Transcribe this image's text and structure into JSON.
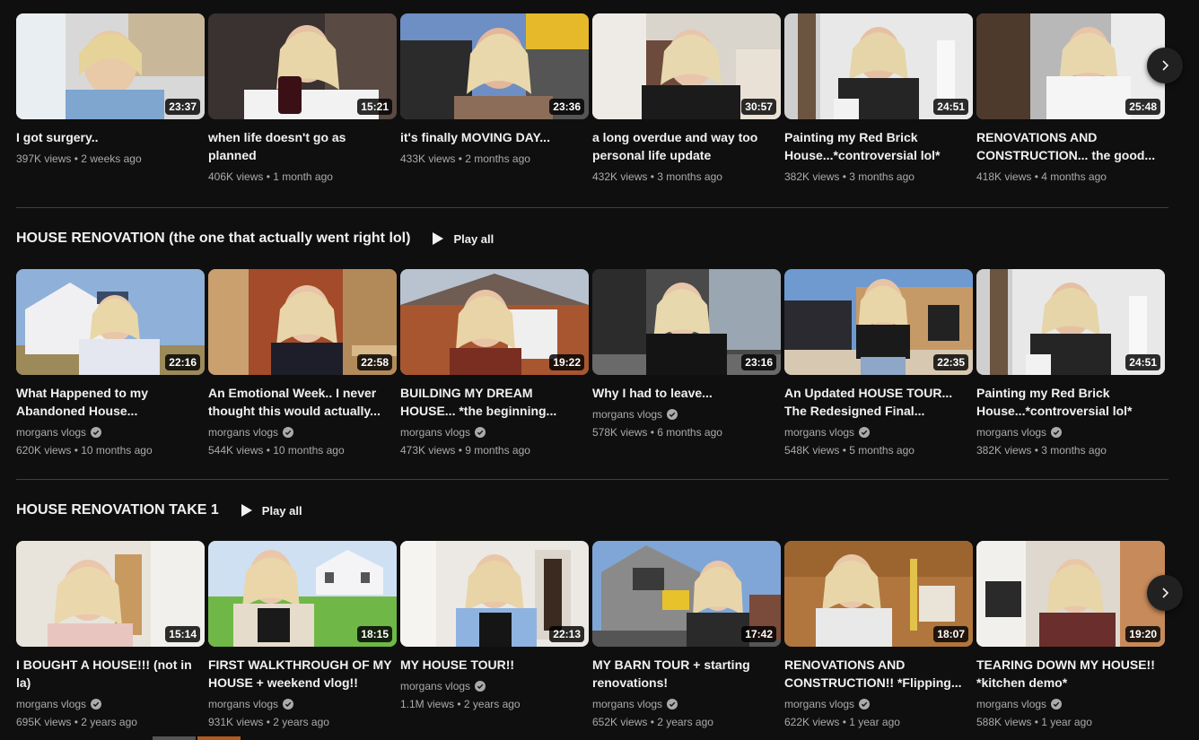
{
  "row1": [
    {
      "title": "I got surgery..",
      "views": "397K views • 2 weeks ago",
      "duration": "23:37"
    },
    {
      "title": "when life doesn't go as planned",
      "views": "406K views • 1 month ago",
      "duration": "15:21"
    },
    {
      "title": "it's finally MOVING DAY...",
      "views": "433K views • 2 months ago",
      "duration": "23:36"
    },
    {
      "title": "a long overdue and way too personal life update",
      "views": "432K views • 3 months ago",
      "duration": "30:57"
    },
    {
      "title": "Painting my Red Brick House...*controversial lol*",
      "views": "382K views • 3 months ago",
      "duration": "24:51"
    },
    {
      "title": "RENOVATIONS AND CONSTRUCTION... the good...",
      "views": "418K views • 4 months ago",
      "duration": "25:48"
    }
  ],
  "shelf1": {
    "title": "HOUSE RENOVATION (the one that actually went right lol)",
    "play_all": "Play all",
    "videos": [
      {
        "title": "What Happened to my Abandoned House...",
        "channel": "morgans vlogs",
        "views": "620K views • 10 months ago",
        "duration": "22:16"
      },
      {
        "title": "An Emotional Week.. I never thought this would actually...",
        "channel": "morgans vlogs",
        "views": "544K views • 10 months ago",
        "duration": "22:58"
      },
      {
        "title": "BUILDING MY DREAM HOUSE... *the beginning...",
        "channel": "morgans vlogs",
        "views": "473K views • 9 months ago",
        "duration": "19:22"
      },
      {
        "title": "Why I had to leave...",
        "channel": "morgans vlogs",
        "views": "578K views • 6 months ago",
        "duration": "23:16"
      },
      {
        "title": "An Updated HOUSE TOUR... The Redesigned Final...",
        "channel": "morgans vlogs",
        "views": "548K views • 5 months ago",
        "duration": "22:35"
      },
      {
        "title": "Painting my Red Brick House...*controversial lol*",
        "channel": "morgans vlogs",
        "views": "382K views • 3 months ago",
        "duration": "24:51"
      }
    ]
  },
  "shelf2": {
    "title": "HOUSE RENOVATION TAKE 1",
    "play_all": "Play all",
    "videos": [
      {
        "title": "I BOUGHT A HOUSE!!! (not in la)",
        "channel": "morgans vlogs",
        "views": "695K views • 2 years ago",
        "duration": "15:14"
      },
      {
        "title": "FIRST WALKTHROUGH OF MY HOUSE + weekend vlog!!",
        "channel": "morgans vlogs",
        "views": "931K views • 2 years ago",
        "duration": "18:15"
      },
      {
        "title": "MY HOUSE TOUR!!",
        "channel": "morgans vlogs",
        "views": "1.1M views • 2 years ago",
        "duration": "22:13"
      },
      {
        "title": "MY BARN TOUR + starting renovations!",
        "channel": "morgans vlogs",
        "views": "652K views • 2 years ago",
        "duration": "17:42"
      },
      {
        "title": "RENOVATIONS AND CONSTRUCTION!! *Flipping...",
        "channel": "morgans vlogs",
        "views": "622K views • 1 year ago",
        "duration": "18:07"
      },
      {
        "title": "TEARING DOWN MY HOUSE!! *kitchen demo*",
        "channel": "morgans vlogs",
        "views": "588K views • 1 year ago",
        "duration": "19:20"
      }
    ]
  },
  "icons": {
    "next": "chevron-right-icon",
    "play": "play-icon",
    "verified": "verified-check-icon"
  },
  "colors": {
    "background": "#0f0f0f",
    "text_primary": "#f1f1f1",
    "text_secondary": "#aaaaaa",
    "divider": "#3f3f3f"
  }
}
